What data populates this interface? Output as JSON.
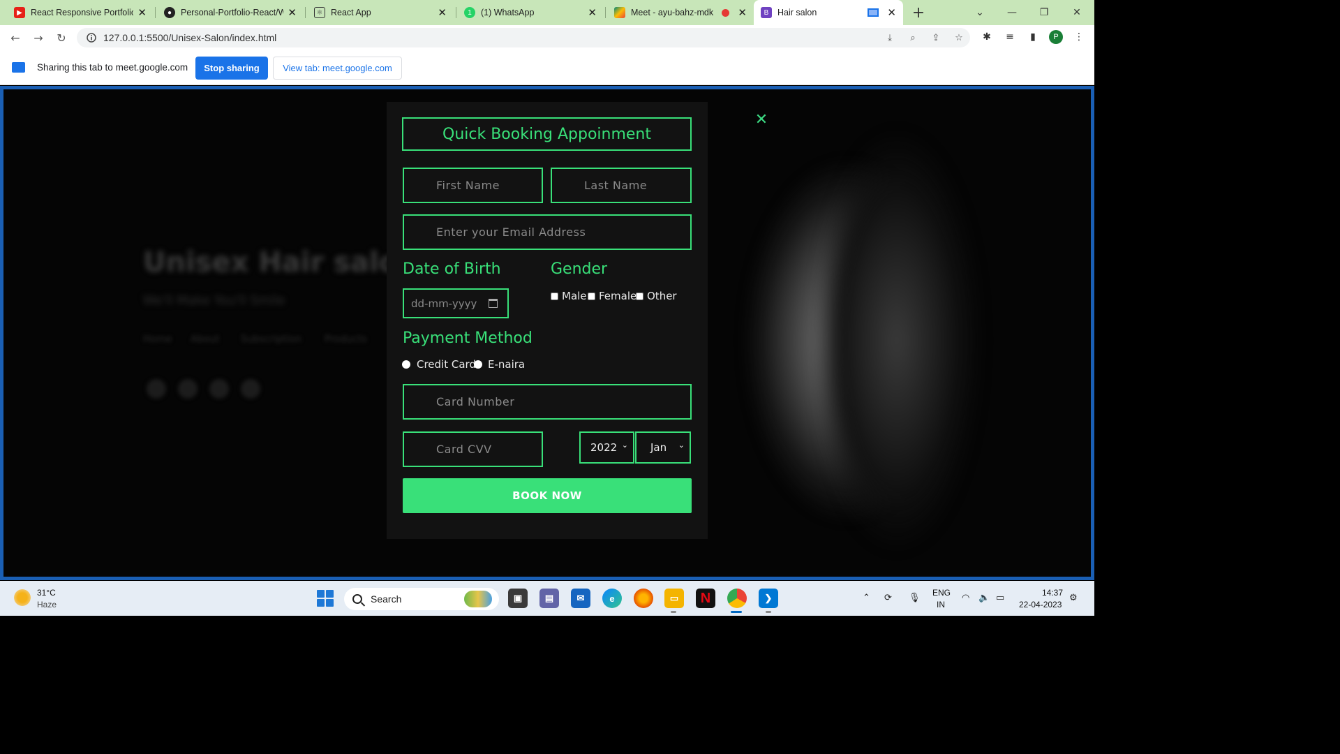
{
  "browser": {
    "tabs": [
      {
        "label": "React Responsive Portfolio",
        "icon": "youtube-icon",
        "close": "✕"
      },
      {
        "label": "Personal-Portfolio-React/W",
        "icon": "github-icon",
        "close": "✕"
      },
      {
        "label": "React App",
        "icon": "react-app-icon",
        "close": "✕"
      },
      {
        "label": "(1) WhatsApp",
        "icon": "whatsapp-icon",
        "close": "✕"
      },
      {
        "label": "Meet - ayu-bahz-mdk",
        "icon": "meet-icon",
        "close": "✕"
      },
      {
        "label": "Hair salon",
        "icon": "bootstrap-icon",
        "close": "✕"
      }
    ],
    "new_tab": "+",
    "url": "127.0.0.1:5500/Unisex-Salon/index.html",
    "profile_initial": "P"
  },
  "sharebar": {
    "text": "Sharing this tab to meet.google.com",
    "stop_label": "Stop sharing",
    "view_label": "View tab: meet.google.com"
  },
  "background_page": {
    "title": "Unisex Hair salon",
    "subtitle": "We'll Make You'll Smile",
    "nav": [
      "Home",
      "About",
      "Subscription",
      "Products"
    ]
  },
  "modal": {
    "title": "Quick Booking Appoinment",
    "close": "✕",
    "first_name_placeholder": "First Name",
    "last_name_placeholder": "Last Name",
    "email_placeholder": "Enter your Email Address",
    "dob_label": "Date of Birth",
    "dob_placeholder": "dd-mm-yyyy",
    "gender_label": "Gender",
    "gender_options": [
      "Male",
      "Female",
      "Other"
    ],
    "payment_label": "Payment Method",
    "payment_options": [
      "Credit Card",
      "E-naira"
    ],
    "card_number_placeholder": "Card Number",
    "card_cvv_placeholder": "Card CVV",
    "year_value": "2022",
    "month_value": "Jan",
    "submit_label": "BOOK NOW"
  },
  "taskbar": {
    "weather_temp": "31°C",
    "weather_cond": "Haze",
    "search_label": "Search",
    "lang_line1": "ENG",
    "lang_line2": "IN",
    "time": "14:37",
    "date": "22-04-2023"
  },
  "colors": {
    "accent": "#39e079",
    "share_blue": "#1a73e8",
    "tabbar": "#c8e6b9"
  }
}
